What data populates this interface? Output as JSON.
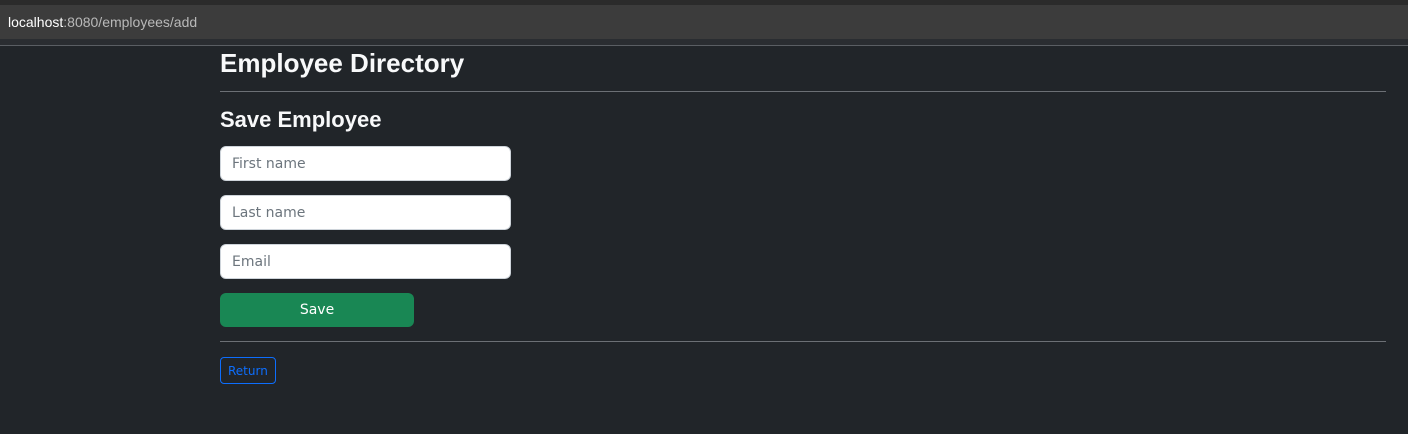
{
  "browser": {
    "url_host": "localhost",
    "url_rest": ":8080/employees/add"
  },
  "page": {
    "title": "Employee Directory",
    "section_title": "Save Employee"
  },
  "form": {
    "first_name": {
      "value": "",
      "placeholder": "First name"
    },
    "last_name": {
      "value": "",
      "placeholder": "Last name"
    },
    "email": {
      "value": "",
      "placeholder": "Email"
    },
    "save_label": "Save"
  },
  "nav": {
    "return_label": "Return"
  },
  "colors": {
    "background": "#212529",
    "save_button": "#198754",
    "link": "#0d6efd"
  }
}
